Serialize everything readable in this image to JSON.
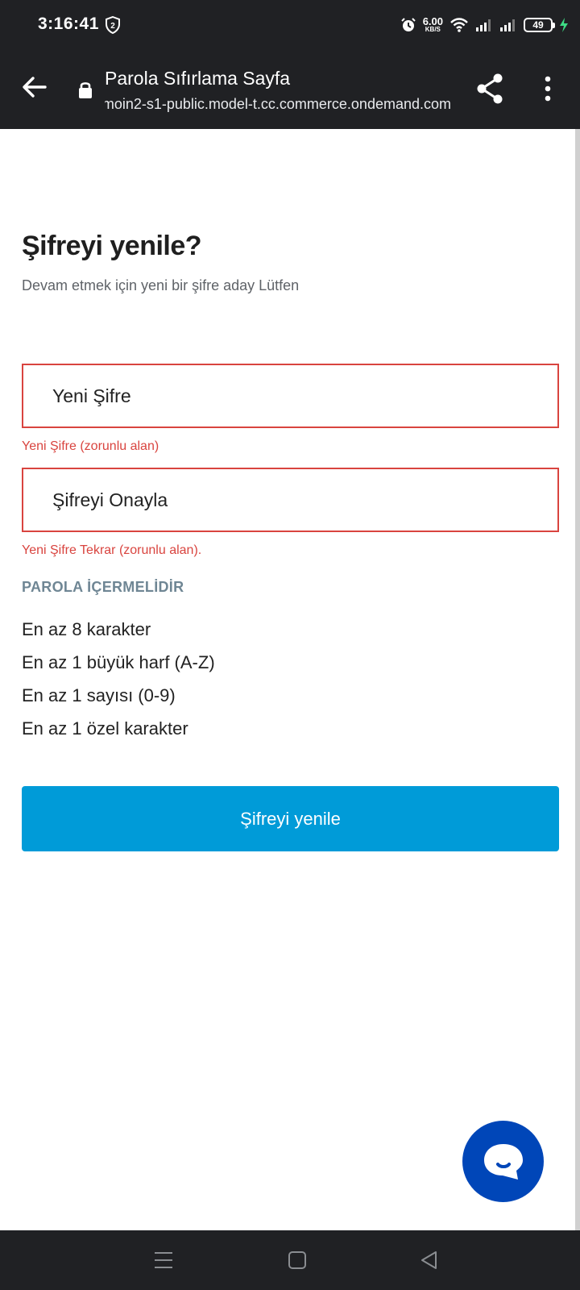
{
  "status_bar": {
    "time": "3:16:41",
    "net_speed_value": "6.00",
    "net_speed_unit": "KB/S",
    "battery_level": "49"
  },
  "browser": {
    "title": "Parola Sıfırlama Sayfa",
    "url": "moin2-s1-public.model-t.cc.commerce.ondemand.com"
  },
  "form": {
    "heading": "Şifreyi yenile?",
    "subheading": "Devam etmek için yeni bir şifre aday Lütfen",
    "new_password_placeholder": "Yeni Şifre",
    "new_password_error": "Yeni Şifre (zorunlu alan)",
    "confirm_password_placeholder": "Şifreyi Onayla",
    "confirm_password_error": "Yeni Şifre Tekrar (zorunlu alan).",
    "requirements_title": "PAROLA İÇERMELİDİR",
    "requirements": [
      "En az 8 karakter",
      "En az 1 büyük harf (A-Z)",
      "En az 1 sayısı (0-9)",
      "En az 1 özel karakter"
    ],
    "submit_label": "Şifreyi yenile"
  },
  "colors": {
    "error": "#d9443f",
    "primary_button": "#009bd8",
    "chat_button": "#0046b8",
    "system_bar": "#202124"
  },
  "icons": {
    "back": "arrow-left-icon",
    "lock": "lock-icon",
    "share": "share-icon",
    "menu": "more-vert-icon",
    "chat": "chat-bubble-icon"
  }
}
